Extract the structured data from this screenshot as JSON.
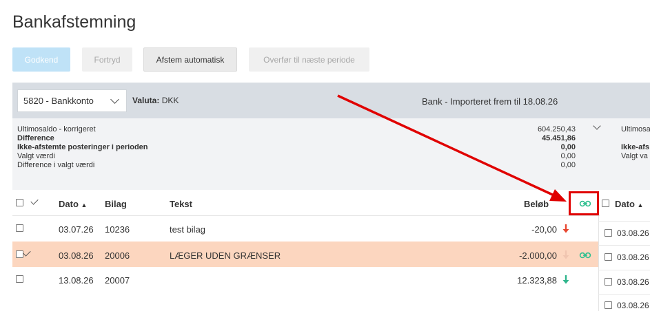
{
  "page": {
    "title": "Bankafstemning"
  },
  "toolbar": {
    "approve_label": "Godkend",
    "undo_label": "Fortryd",
    "auto_reconcile_label": "Afstem automatisk",
    "transfer_label": "Overfør til næste periode"
  },
  "account": {
    "selected": "5820 - Bankkonto",
    "currency_label": "Valuta:",
    "currency_value": "DKK"
  },
  "bank_header": "Bank - Importeret frem til 18.08.26",
  "summary": [
    {
      "label": "Ultimosaldo - korrigeret",
      "value": "604.250,43",
      "bold": false
    },
    {
      "label": "Difference",
      "value": "45.451,86",
      "bold": true
    },
    {
      "label": "Ikke-afstemte posteringer i perioden",
      "value": "0,00",
      "bold": true
    },
    {
      "label": "Valgt værdi",
      "value": "0,00",
      "bold": false
    },
    {
      "label": "Difference i valgt værdi",
      "value": "0,00",
      "bold": false
    }
  ],
  "right_summary": [
    "Ultimosa",
    "Ikke-afs",
    "Valgt va"
  ],
  "table": {
    "columns": {
      "date": "Dato",
      "voucher": "Bilag",
      "text": "Tekst",
      "amount": "Beløb"
    },
    "rows": [
      {
        "date": "03.07.26",
        "voucher": "10236",
        "text": "test bilag",
        "amount": "-20,00",
        "direction": "down",
        "arrow_color": "#e8462f",
        "checked_mark": false,
        "linked": false
      },
      {
        "date": "03.08.26",
        "voucher": "20006",
        "text": "LÆGER UDEN GRÆNSER",
        "amount": "-2.000,00",
        "direction": "down",
        "arrow_color": "#f0c5b0",
        "checked_mark": true,
        "linked": true
      },
      {
        "date": "13.08.26",
        "voucher": "20007",
        "text": "",
        "amount": "12.323,88",
        "direction": "up",
        "arrow_color": "#2fb58c",
        "checked_mark": false,
        "linked": false
      }
    ]
  },
  "right_table": {
    "date_header": "Dato",
    "dates": [
      "03.08.26",
      "03.08.26",
      "03.08.26",
      "03.08.26"
    ]
  },
  "colors": {
    "link_icon": "#2fbf8f",
    "highlight_row": "#fcd6bf",
    "annotation_red": "#e00000",
    "primary_button": "#bfe2f7"
  }
}
